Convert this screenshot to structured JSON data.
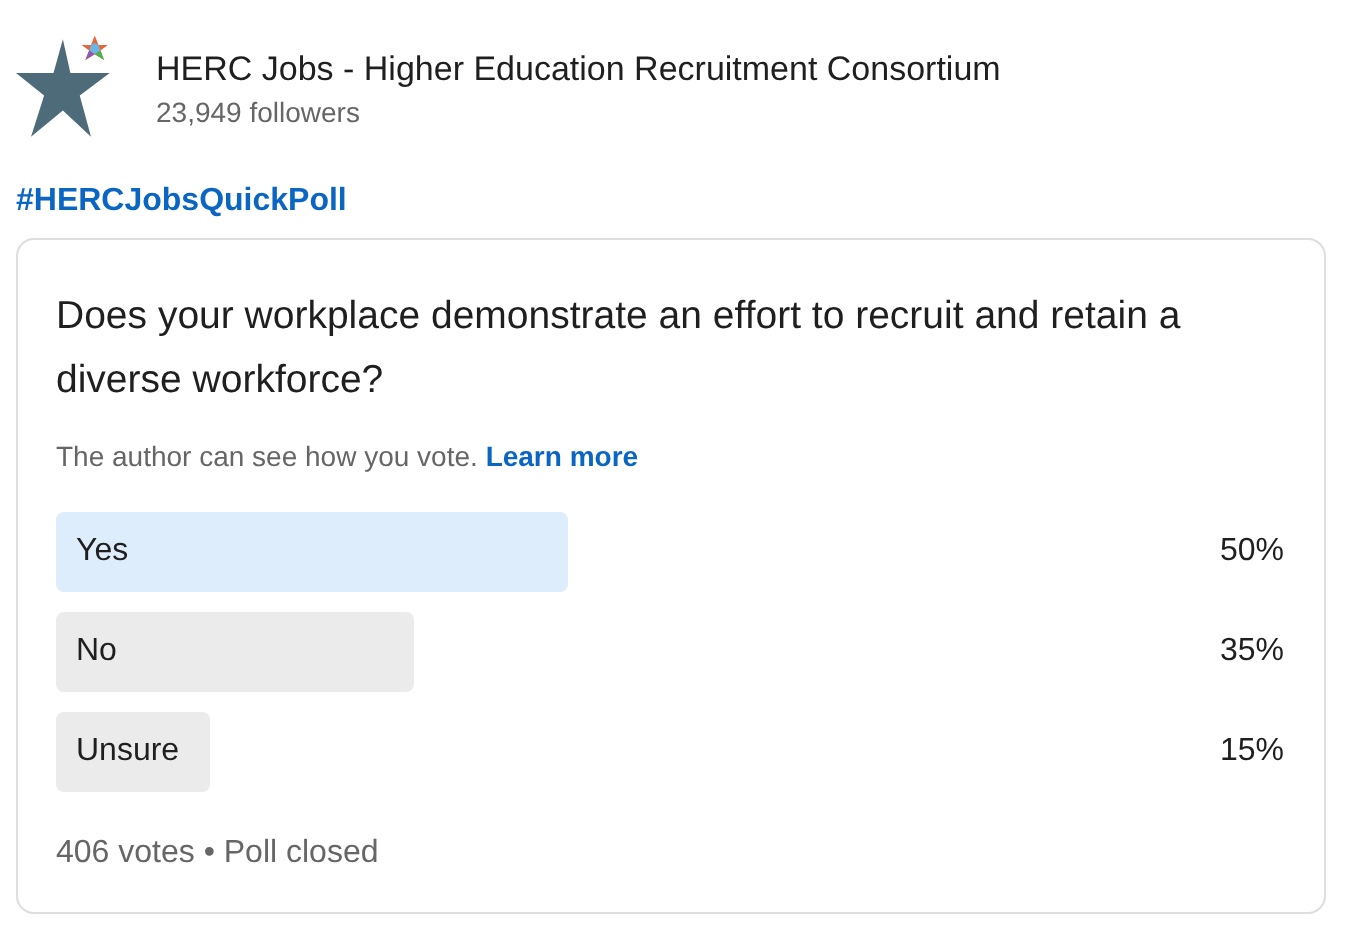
{
  "author": {
    "name": "HERC Jobs - Higher Education Recruitment Consortium",
    "followers": "23,949 followers"
  },
  "hashtag": "#HERCJobsQuickPoll",
  "poll": {
    "question": "Does your workplace demonstrate an effort to recruit and retain a diverse workforce?",
    "note": "The author can see how you vote.",
    "note_link": "Learn more",
    "options": [
      {
        "label": "Yes",
        "percent": "50%",
        "selected": true
      },
      {
        "label": "No",
        "percent": "35%",
        "selected": false
      },
      {
        "label": "Unsure",
        "percent": "15%",
        "selected": false
      }
    ],
    "footer": "406 votes • Poll closed"
  }
}
